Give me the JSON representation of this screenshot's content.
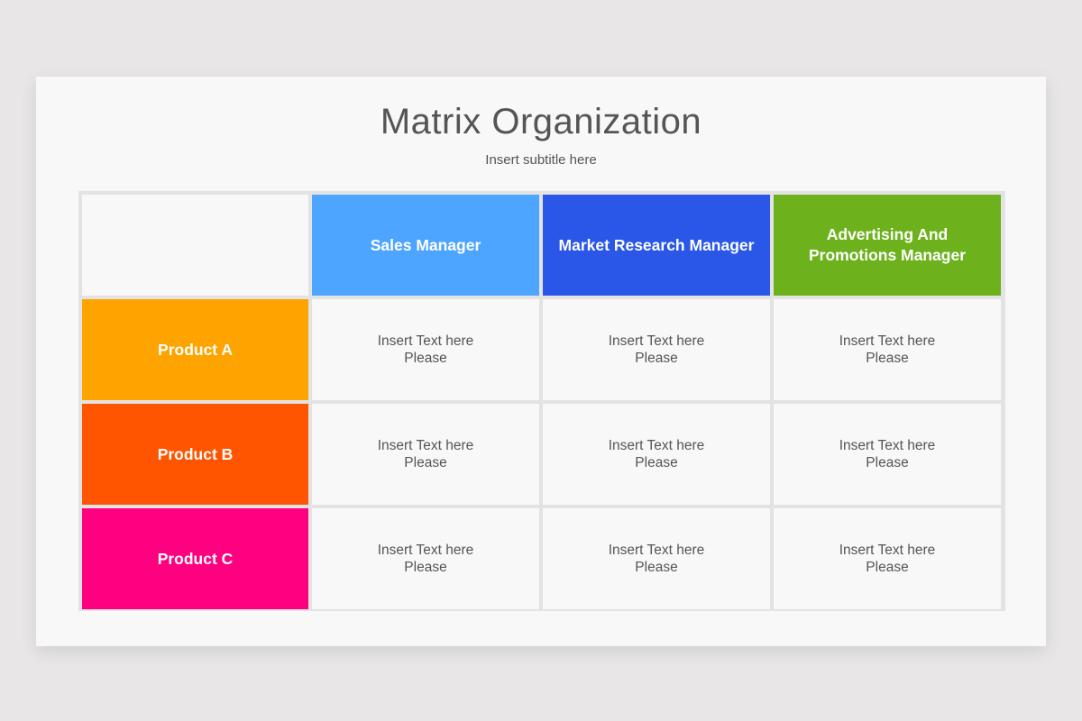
{
  "title": "Matrix Organization",
  "subtitle": "Insert subtitle here",
  "columns": [
    {
      "label": "Sales Manager",
      "color": "#4ea5ff"
    },
    {
      "label": "Market Research Manager",
      "color": "#2a57e8"
    },
    {
      "label": "Advertising And Promotions Manager",
      "color": "#6db21c"
    }
  ],
  "rows": [
    {
      "label": "Product A",
      "color": "#fda400",
      "cells": [
        "Insert Text here Please",
        "Insert Text here Please",
        "Insert Text here Please"
      ]
    },
    {
      "label": "Product B",
      "color": "#ff5500",
      "cells": [
        "Insert Text here Please",
        "Insert Text here Please",
        "Insert Text here Please"
      ]
    },
    {
      "label": "Product C",
      "color": "#ff0080",
      "cells": [
        "Insert Text here Please",
        "Insert Text here Please",
        "Insert Text here Please"
      ]
    }
  ]
}
